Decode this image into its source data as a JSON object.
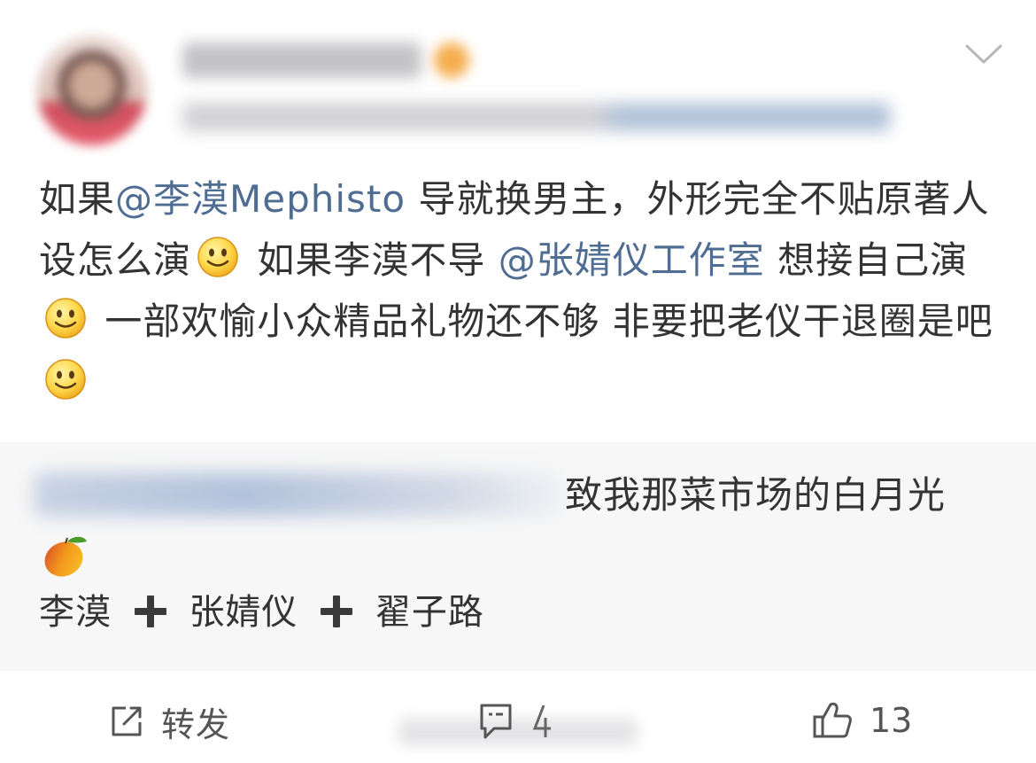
{
  "post": {
    "content": [
      {
        "type": "text",
        "text": "如果"
      },
      {
        "type": "mention",
        "text": "@李漠Mephisto"
      },
      {
        "type": "text",
        "text": " 导就换男主，外形完全不贴原著人设怎么演"
      },
      {
        "type": "emoji",
        "icon": "smiley-emoji"
      },
      {
        "type": "text",
        "text": " 如果李漠不导 "
      },
      {
        "type": "mention",
        "text": "@张婧仪工作室"
      },
      {
        "type": "text",
        "text": " 想接自己演"
      },
      {
        "type": "emoji",
        "icon": "smiley-emoji"
      },
      {
        "type": "text",
        "text": " 一部欢愉小众精品礼物还不够 非要把老仪干退圈是吧"
      },
      {
        "type": "emoji",
        "icon": "smiley-emoji"
      }
    ]
  },
  "repost": {
    "text": "致我那菜市场的白月光",
    "emoji_icon": "mango-emoji",
    "tags": [
      "李漠",
      "张婧仪",
      "翟子路"
    ],
    "separator_icon": "plus-icon"
  },
  "footer": {
    "repost_label": "转发",
    "like_count": "13",
    "icons": {
      "repost": "share-icon",
      "comment": "comment-icon",
      "like": "thumbs-up-icon"
    }
  },
  "colors": {
    "mention": "#4f6d93",
    "text": "#333333",
    "repost_bg": "#f7f7f7",
    "muted": "#555555"
  }
}
